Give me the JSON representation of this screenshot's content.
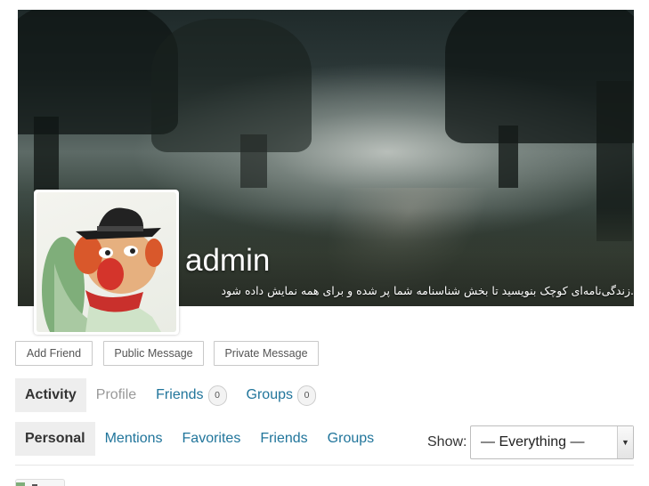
{
  "profile": {
    "name": "admin",
    "bio": ".زندگی‌نامه‌ای کوچک بنویسید تا بخش شناسنامه شما پر شده و برای همه نمایش داده شود"
  },
  "actions": {
    "add_friend": "Add Friend",
    "public_message": "Public Message",
    "private_message": "Private Message"
  },
  "primary_nav": [
    {
      "label": "Activity",
      "current": true
    },
    {
      "label": "Profile"
    },
    {
      "label": "Friends",
      "count": "0"
    },
    {
      "label": "Groups",
      "count": "0"
    }
  ],
  "secondary_nav": [
    {
      "label": "Personal",
      "current": true
    },
    {
      "label": "Mentions"
    },
    {
      "label": "Favorites"
    },
    {
      "label": "Friends"
    },
    {
      "label": "Groups"
    }
  ],
  "filter": {
    "label": "Show:",
    "selected": "— Everything —"
  },
  "colors": {
    "link": "#21759b",
    "current_tab_bg": "#eeeeee"
  }
}
